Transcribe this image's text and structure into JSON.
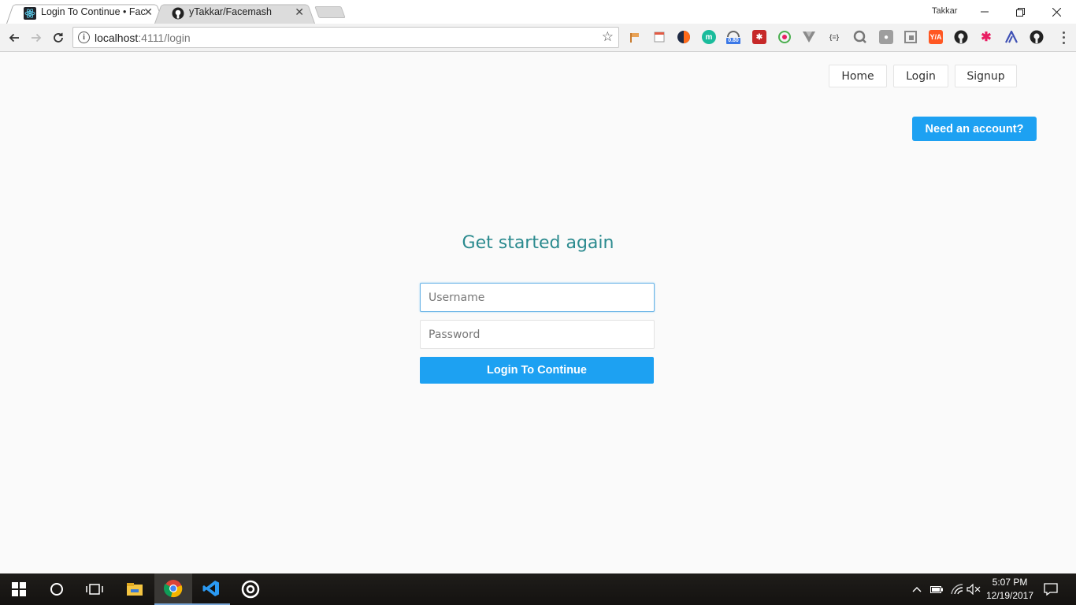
{
  "browser": {
    "tabs": [
      {
        "title": "Login To Continue • Face",
        "icon": "react-icon",
        "active": true
      },
      {
        "title": "yTakkar/Facemash",
        "icon": "github-icon",
        "active": false
      }
    ],
    "profile_name": "Takkar",
    "url_host": "localhost",
    "url_rest": ":4111/login",
    "extension_badge": "0.80",
    "extensions": [
      "flag-ext-icon",
      "note-ext-icon",
      "compass-ext-icon",
      "m-ext-icon",
      "speed-ext-icon",
      "puzzle-ext-icon",
      "eye-ext-icon",
      "vue-ext-icon",
      "json-ext-icon",
      "search-ext-icon",
      "chat-ext-icon",
      "box-ext-icon",
      "y-ext-icon",
      "github-ext-icon",
      "star-ext-icon",
      "lambda-ext-icon",
      "github2-ext-icon"
    ]
  },
  "site_nav": {
    "home": "Home",
    "login": "Login",
    "signup": "Signup"
  },
  "need_account": "Need an account?",
  "form": {
    "heading": "Get started again",
    "username_placeholder": "Username",
    "password_placeholder": "Password",
    "submit_label": "Login To Continue"
  },
  "taskbar": {
    "time": "5:07 PM",
    "date": "12/19/2017"
  },
  "colors": {
    "accent": "#1da1f2",
    "heading": "#2a8a8e",
    "page_bg": "#fafafa"
  }
}
